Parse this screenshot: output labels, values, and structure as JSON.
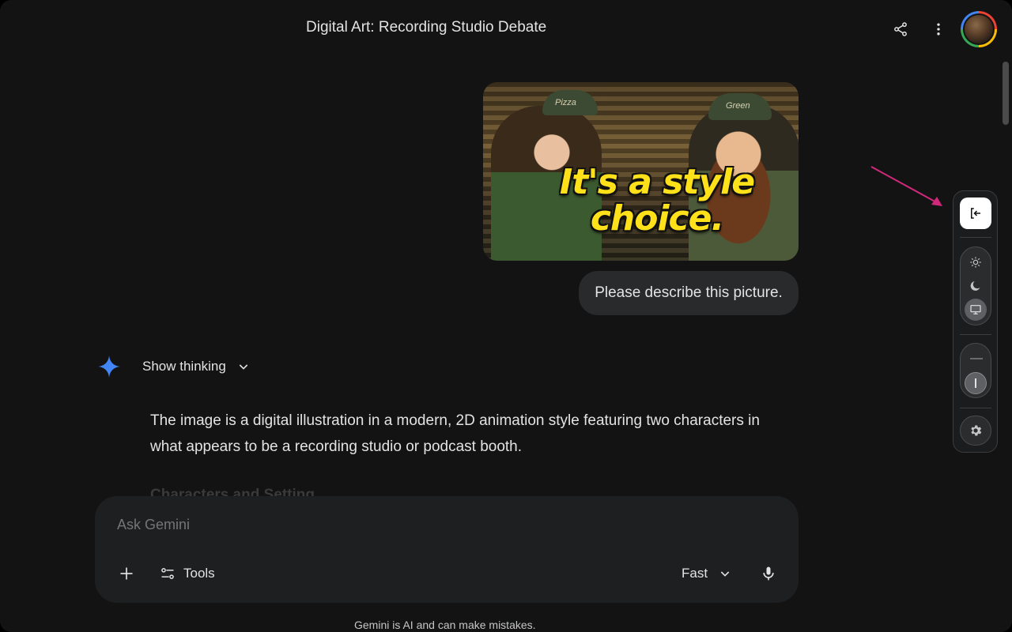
{
  "header": {
    "title": "Digital Art: Recording Studio Debate",
    "share_icon": "share-icon",
    "more_icon": "more-vert-icon",
    "avatar_icon": "account-avatar"
  },
  "user_message": {
    "image": {
      "caption": "It's a style choice.",
      "hat_left": "Pizza",
      "hat_right": "Green"
    },
    "text": "Please describe this picture."
  },
  "response": {
    "thinking_label": "Show thinking",
    "paragraph": "The image is a digital illustration in a modern, 2D animation style featuring two characters in what appears to be a recording studio or podcast booth.",
    "next_heading": "Characters and Setting"
  },
  "composer": {
    "placeholder": "Ask Gemini",
    "tools_label": "Tools",
    "mode_label": "Fast"
  },
  "footer": {
    "disclaimer": "Gemini is AI and can make mistakes."
  },
  "side_panel": {
    "exit_icon": "exit-icon",
    "theme_options": [
      "light",
      "dark",
      "system"
    ],
    "theme_selected": "system",
    "settings_icon": "gear-icon"
  },
  "colors": {
    "background": "#131314",
    "surface": "#1e1f20",
    "bubble": "#282a2c",
    "caption_yellow": "#ffe11a",
    "arrow": "#d1297a",
    "spark_blue": "#4285f4"
  }
}
